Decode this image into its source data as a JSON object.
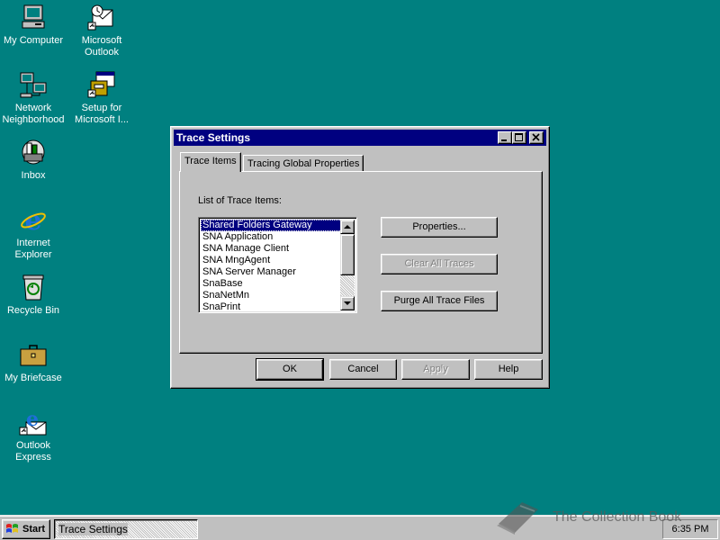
{
  "desktop": {
    "icons": [
      {
        "label": "My Computer",
        "icon": "computer-icon"
      },
      {
        "label": "Microsoft Outlook",
        "icon": "outlook-icon"
      },
      {
        "label": "Network Neighborhood",
        "icon": "network-icon"
      },
      {
        "label": "Setup for Microsoft I...",
        "icon": "setup-icon"
      },
      {
        "label": "Inbox",
        "icon": "inbox-icon"
      },
      {
        "label": "Internet Explorer",
        "icon": "internet-explorer-icon"
      },
      {
        "label": "Recycle Bin",
        "icon": "recycle-bin-icon"
      },
      {
        "label": "My Briefcase",
        "icon": "briefcase-icon"
      },
      {
        "label": "Outlook Express",
        "icon": "outlook-express-icon"
      }
    ]
  },
  "dialog": {
    "title": "Trace Settings",
    "tabs": [
      {
        "label": "Trace Items",
        "active": true
      },
      {
        "label": "Tracing Global Properties",
        "active": false
      }
    ],
    "list_label": "List of Trace Items:",
    "list_items": [
      "Shared Folders Gateway",
      "SNA  Application",
      "SNA Manage Client",
      "SNA MngAgent",
      "SNA Server Manager",
      "SnaBase",
      "SnaNetMn",
      "SnaPrint"
    ],
    "selected_item": "Shared Folders Gateway",
    "buttons": {
      "properties": "Properties...",
      "clear_all": "Clear All Traces",
      "purge_all": "Purge All Trace Files",
      "ok": "OK",
      "cancel": "Cancel",
      "apply": "Apply",
      "help": "Help"
    }
  },
  "taskbar": {
    "start_label": "Start",
    "task_label": "Trace Settings",
    "clock": "6:35 PM"
  },
  "watermark": "The Collection Book",
  "colors": {
    "desktop": "#008080",
    "titlebar": "#000080",
    "face": "#c0c0c0"
  }
}
